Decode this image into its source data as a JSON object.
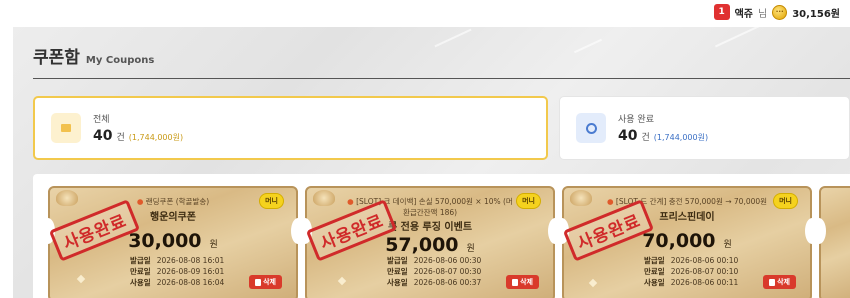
{
  "header": {
    "level": "1",
    "username": "액쥬",
    "honorific": "님",
    "coin_symbol": "···",
    "points": "30,156원"
  },
  "page": {
    "title": "쿠폰함",
    "subtitle": "My Coupons"
  },
  "stats": {
    "total": {
      "label": "전체",
      "count": "40",
      "unit": "건",
      "amount": "(1,744,000원)",
      "icon": "folder-icon"
    },
    "used": {
      "label": "사용 완료",
      "count": "40",
      "unit": "건",
      "amount": "(1,744,000원)",
      "icon": "check-circle-icon"
    }
  },
  "coupons": [
    {
      "desc": "랜딩쿠폰 (학골발송)",
      "name": "행운의쿠폰",
      "amount": "30,000",
      "won": "원",
      "badge": "머니",
      "issued_label": "발급일",
      "issued": "2026-08-08 16:01",
      "expire_label": "만료일",
      "expire": "2026-08-09 16:01",
      "used_label": "사용일",
      "used": "2026-08-08 16:04",
      "stamp": "사용완료",
      "delete": "삭제"
    },
    {
      "desc": "[SLOT] 크 데이백] 손실 570,000원 × 10% (머",
      "desc2": "환급간잔액 186)",
      "name": "롯 전용 루징 이벤트",
      "amount": "57,000",
      "won": "원",
      "badge": "머니",
      "issued_label": "발급일",
      "issued": "2026-08-06 00:30",
      "expire_label": "만료일",
      "expire": "2026-08-07 00:30",
      "used_label": "사용일",
      "used": "2026-08-06 00:37",
      "stamp": "사용완료",
      "delete": "삭제"
    },
    {
      "desc": "[SLOT 드 간계] 충전 570,000원 → 70,000원",
      "name": "프리스핀데이",
      "amount": "70,000",
      "won": "원",
      "badge": "머니",
      "issued_label": "발급일",
      "issued": "2026-08-06 00:10",
      "expire_label": "만료일",
      "expire": "2026-08-07 00:10",
      "used_label": "사용일",
      "used": "2026-08-06 00:11",
      "stamp": "사용완료",
      "delete": "삭제"
    }
  ]
}
